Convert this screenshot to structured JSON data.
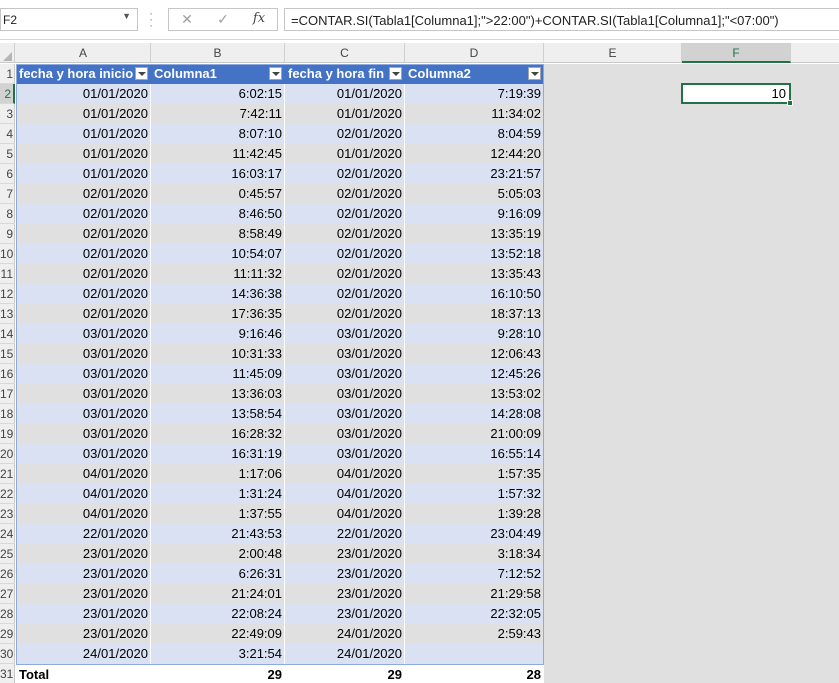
{
  "name_box": "F2",
  "formula": "=CONTAR.SI(Tabla1[Columna1];\">22:00\")+CONTAR.SI(Tabla1[Columna1];\"<07:00\")",
  "columns": [
    "A",
    "B",
    "C",
    "D",
    "E",
    "F"
  ],
  "selected_column": "F",
  "selected_row": 2,
  "table_headers": [
    "fecha y hora inicio",
    "Columna1",
    "fecha y hora fin",
    "Columna2"
  ],
  "rows": [
    [
      "01/01/2020",
      "6:02:15",
      "01/01/2020",
      "7:19:39"
    ],
    [
      "01/01/2020",
      "7:42:11",
      "01/01/2020",
      "11:34:02"
    ],
    [
      "01/01/2020",
      "8:07:10",
      "02/01/2020",
      "8:04:59"
    ],
    [
      "01/01/2020",
      "11:42:45",
      "01/01/2020",
      "12:44:20"
    ],
    [
      "01/01/2020",
      "16:03:17",
      "02/01/2020",
      "23:21:57"
    ],
    [
      "02/01/2020",
      "0:45:57",
      "02/01/2020",
      "5:05:03"
    ],
    [
      "02/01/2020",
      "8:46:50",
      "02/01/2020",
      "9:16:09"
    ],
    [
      "02/01/2020",
      "8:58:49",
      "02/01/2020",
      "13:35:19"
    ],
    [
      "02/01/2020",
      "10:54:07",
      "02/01/2020",
      "13:52:18"
    ],
    [
      "02/01/2020",
      "11:11:32",
      "02/01/2020",
      "13:35:43"
    ],
    [
      "02/01/2020",
      "14:36:38",
      "02/01/2020",
      "16:10:50"
    ],
    [
      "02/01/2020",
      "17:36:35",
      "02/01/2020",
      "18:37:13"
    ],
    [
      "03/01/2020",
      "9:16:46",
      "03/01/2020",
      "9:28:10"
    ],
    [
      "03/01/2020",
      "10:31:33",
      "03/01/2020",
      "12:06:43"
    ],
    [
      "03/01/2020",
      "11:45:09",
      "03/01/2020",
      "12:45:26"
    ],
    [
      "03/01/2020",
      "13:36:03",
      "03/01/2020",
      "13:53:02"
    ],
    [
      "03/01/2020",
      "13:58:54",
      "03/01/2020",
      "14:28:08"
    ],
    [
      "03/01/2020",
      "16:28:32",
      "03/01/2020",
      "21:00:09"
    ],
    [
      "03/01/2020",
      "16:31:19",
      "03/01/2020",
      "16:55:14"
    ],
    [
      "04/01/2020",
      "1:17:06",
      "04/01/2020",
      "1:57:35"
    ],
    [
      "04/01/2020",
      "1:31:24",
      "04/01/2020",
      "1:57:32"
    ],
    [
      "04/01/2020",
      "1:37:55",
      "04/01/2020",
      "1:39:28"
    ],
    [
      "22/01/2020",
      "21:43:53",
      "22/01/2020",
      "23:04:49"
    ],
    [
      "23/01/2020",
      "2:00:48",
      "23/01/2020",
      "3:18:34"
    ],
    [
      "23/01/2020",
      "6:26:31",
      "23/01/2020",
      "7:12:52"
    ],
    [
      "23/01/2020",
      "21:24:01",
      "23/01/2020",
      "21:29:58"
    ],
    [
      "23/01/2020",
      "22:08:24",
      "23/01/2020",
      "22:32:05"
    ],
    [
      "23/01/2020",
      "22:49:09",
      "24/01/2020",
      "2:59:43"
    ],
    [
      "24/01/2020",
      "3:21:54",
      "24/01/2020",
      ""
    ]
  ],
  "total_row": [
    "Total",
    "29",
    "29",
    "28"
  ],
  "f2_value": "10",
  "colors": {
    "table_header": "#4472c4",
    "band": "#d9e1f2",
    "selection": "#217346"
  }
}
